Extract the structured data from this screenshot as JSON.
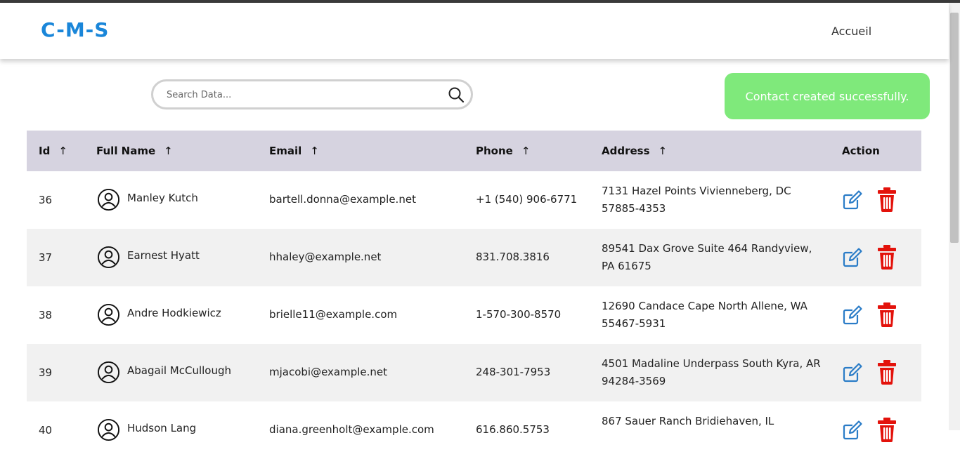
{
  "app": {
    "brand": "C-M-S",
    "nav": {
      "home": "Accueil"
    }
  },
  "search": {
    "placeholder": "Search Data..."
  },
  "toast": {
    "message": "Contact created successfully.",
    "color": "#7fe97b"
  },
  "table": {
    "headers": {
      "id": "Id",
      "full_name": "Full Name",
      "email": "Email",
      "phone": "Phone",
      "address": "Address",
      "action": "Action",
      "sort_arrow": "↑"
    },
    "rows": [
      {
        "id": "36",
        "name": "Manley Kutch",
        "email": "bartell.donna@example.net",
        "phone": "+1 (540) 906-6771",
        "address": "7131 Hazel Points Vivienneberg, DC 57885-4353"
      },
      {
        "id": "37",
        "name": "Earnest Hyatt",
        "email": "hhaley@example.net",
        "phone": "831.708.3816",
        "address": "89541 Dax Grove Suite 464 Randyview, PA 61675"
      },
      {
        "id": "38",
        "name": "Andre Hodkiewicz",
        "email": "brielle11@example.com",
        "phone": "1-570-300-8570",
        "address": "12690 Candace Cape North Allene, WA 55467-5931"
      },
      {
        "id": "39",
        "name": "Abagail McCullough",
        "email": "mjacobi@example.net",
        "phone": "248-301-7953",
        "address": "4501 Madaline Underpass South Kyra, AR 94284-3569"
      },
      {
        "id": "40",
        "name": "Hudson Lang",
        "email": "diana.greenholt@example.com",
        "phone": "616.860.5753",
        "address": "867 Sauer Ranch Bridiehaven, IL"
      }
    ]
  },
  "colors": {
    "brand": "#1a86d9",
    "header_bg": "#d6d3e0",
    "delete": "#e3120b",
    "edit": "#2a7cc7"
  }
}
